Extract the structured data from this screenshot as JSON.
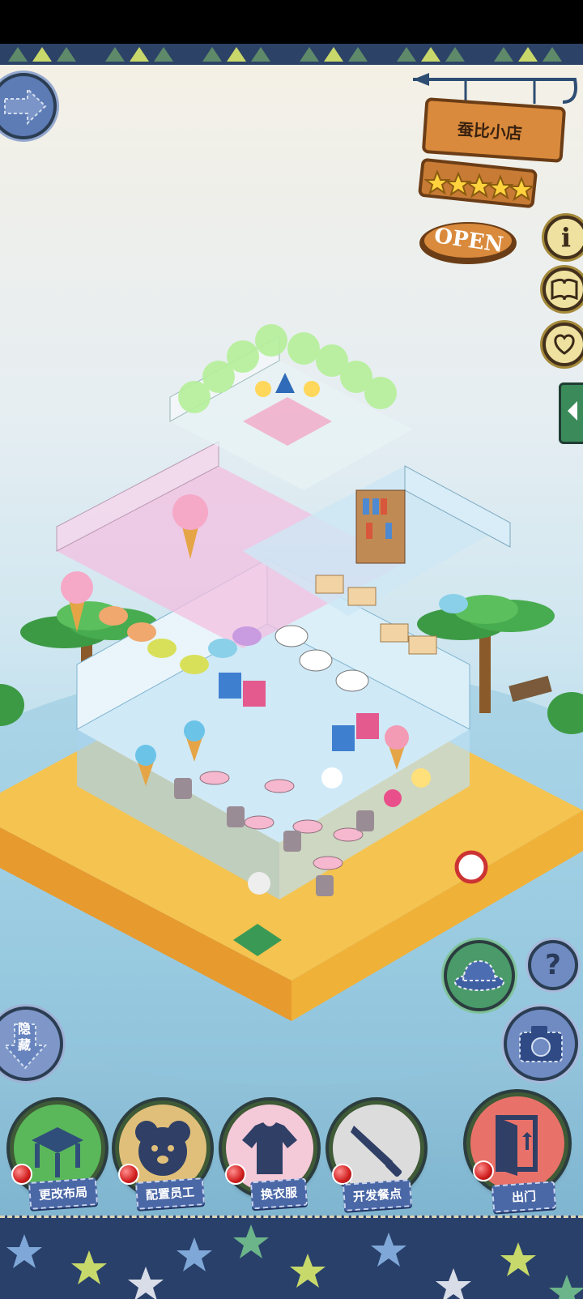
{
  "shop_sign": {
    "name": "蚕比小店",
    "rating_stars": 5,
    "open_label": "OPEN"
  },
  "nav": {
    "forward_icon": "arrow-right-icon",
    "hide_label": "隐藏"
  },
  "side_buttons": [
    {
      "icon": "info-icon"
    },
    {
      "icon": "book-icon"
    },
    {
      "icon": "heart-icon"
    }
  ],
  "right_tools": {
    "hat_icon": "hat-icon",
    "help_icon": "question-icon",
    "camera_icon": "camera-icon"
  },
  "bottom_actions": [
    {
      "label": "更改布局",
      "icon": "table-icon"
    },
    {
      "label": "配置员工",
      "icon": "bear-icon"
    },
    {
      "label": "换衣服",
      "icon": "shirt-icon"
    },
    {
      "label": "开发餐点",
      "icon": "knife-icon"
    },
    {
      "label": "出门",
      "icon": "door-icon"
    }
  ],
  "colors": {
    "navy_band": "#29406a",
    "button_label_bg": "#4a67a6",
    "sign_wood": "#d98a3c"
  }
}
